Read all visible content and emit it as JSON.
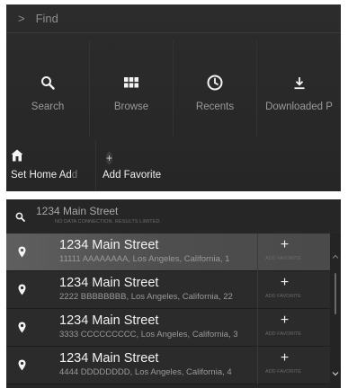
{
  "find_bar": {
    "label": "Find"
  },
  "tiles": [
    {
      "label": "Search",
      "icon": "search-icon"
    },
    {
      "label": "Browse",
      "icon": "grid-icon"
    },
    {
      "label": "Recents",
      "icon": "clock-icon"
    },
    {
      "label": "Downloaded P",
      "icon": "download-icon"
    }
  ],
  "shortcuts": {
    "home": {
      "label": "Set Home Ad",
      "label_fade": "d",
      "icon": "home-icon"
    },
    "favorite": {
      "label": "Add Favorite",
      "icon": "plus-icon"
    }
  },
  "search": {
    "query": "1234 Main Street",
    "note": "NO DATA CONNECTION. RESULTS LIMITED."
  },
  "results": [
    {
      "title": "1234 Main Street",
      "subtitle": "11111 AAAAAAAA, Los Angeles, California, 1",
      "favorite_label": "ADD FAVORITE"
    },
    {
      "title": "1234 Main Street",
      "subtitle": "2222 BBBBBBBB, Los Angeles, California, 22",
      "favorite_label": "ADD FAVORITE"
    },
    {
      "title": "1234 Main Street",
      "subtitle": "3333 CCCCCCCCC, Los Angeles, California, 3",
      "favorite_label": "ADD FAVORITE"
    },
    {
      "title": "1234 Main Street",
      "subtitle": "4444 DDDDDDDD, Los Angeles, California, 4",
      "favorite_label": "ADD FAVORITE"
    }
  ],
  "colors": {
    "panel_bg": "#2a2a2a",
    "selected_row": "#5a5a5a",
    "text_primary": "#f2f2f2",
    "text_secondary": "#9a9a9a"
  }
}
